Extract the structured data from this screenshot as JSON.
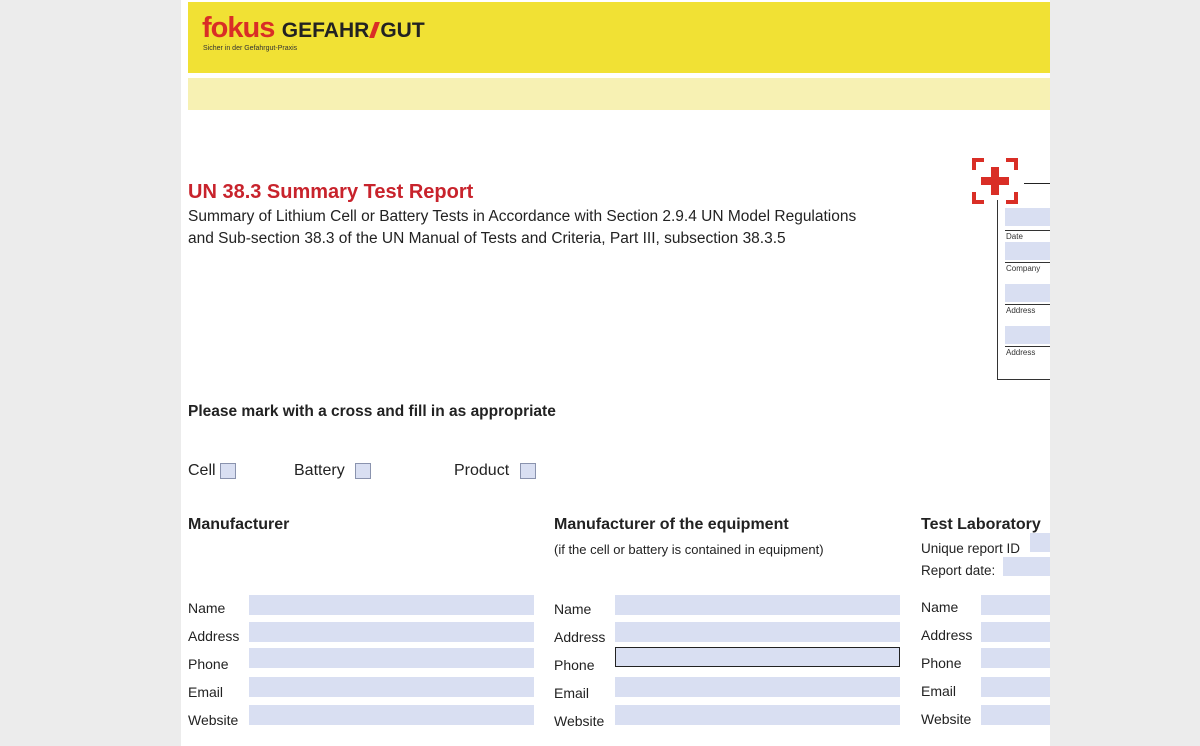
{
  "header": {
    "logo_fokus": "fokus",
    "logo_gefahr": "GEFAHR",
    "logo_gut": "GUT",
    "tagline": "Sicher in der Gefahrgut-Praxis"
  },
  "report": {
    "title": "UN 38.3 Summary Test Report",
    "subtitle_line1": "Summary of Lithium Cell or Battery Tests in Accordance with Section 2.9.4 UN Model Regulations",
    "subtitle_line2": "and Sub-section 38.3 of the UN Manual of Tests and Criteria, Part III, subsection 38.3.5"
  },
  "sidebox": {
    "labels": [
      "Date",
      "Company",
      "Address",
      "Address"
    ]
  },
  "instruction": "Please mark with a cross and fill in as appropriate",
  "checkboxes": [
    {
      "label": "Cell",
      "checked": false
    },
    {
      "label": "Battery",
      "checked": false
    },
    {
      "label": "Product",
      "checked": false
    }
  ],
  "sections": {
    "manufacturer": {
      "title": "Manufacturer",
      "fields": [
        "Name",
        "Address",
        "Phone",
        "Email",
        "Website"
      ]
    },
    "equipment_manufacturer": {
      "title": "Manufacturer of the equipment",
      "note": "(if the cell or battery is contained in equipment)",
      "fields": [
        "Name",
        "Address",
        "Phone",
        "Email",
        "Website"
      ]
    },
    "test_laboratory": {
      "title": "Test Laboratory",
      "unique_report_id_label": "Unique report ID",
      "report_date_label": "Report date:",
      "fields": [
        "Name",
        "Address",
        "Phone",
        "Email",
        "Website"
      ]
    }
  },
  "colors": {
    "brand_yellow": "#f1e134",
    "brand_red": "#d92e26",
    "title_red": "#c8232c",
    "field_fill": "#d9dff2"
  }
}
